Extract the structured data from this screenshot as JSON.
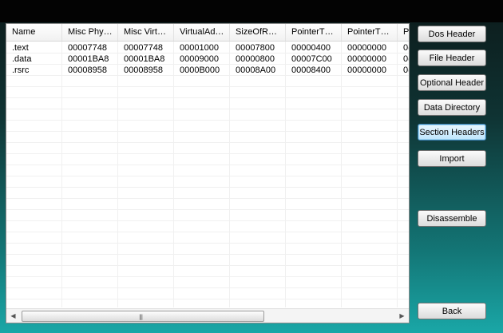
{
  "table": {
    "columns": [
      "Name",
      "Misc Phy…",
      "Misc Virt…",
      "VirtualAd…",
      "SizeOfR…",
      "PointerT…",
      "PointerT…",
      "P"
    ],
    "rows": [
      [
        ".text",
        "00007748",
        "00007748",
        "00001000",
        "00007800",
        "00000400",
        "00000000",
        "0("
      ],
      [
        ".data",
        "00001BA8",
        "00001BA8",
        "00009000",
        "00000800",
        "00007C00",
        "00000000",
        "0("
      ],
      [
        ".rsrc",
        "00008958",
        "00008958",
        "0000B000",
        "00008A00",
        "00008400",
        "00000000",
        "0("
      ]
    ],
    "scroll_grip": "|||"
  },
  "buttons": {
    "dos_header": "Dos Header",
    "file_header": "File Header",
    "optional_header": "Optional Header",
    "data_directory": "Data Directory",
    "section_headers": "Section Headers",
    "import": "Import",
    "disassemble": "Disassemble",
    "back": "Back"
  },
  "icons": {
    "scroll_left": "left-arrow-icon",
    "scroll_right": "right-arrow-icon"
  }
}
